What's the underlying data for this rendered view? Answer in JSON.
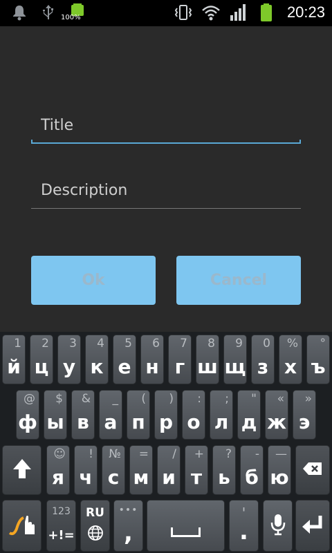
{
  "status_bar": {
    "battery_percent_left": "100%",
    "time": "20:23",
    "icons": [
      "notification-bell-icon",
      "usb-icon",
      "battery-icon",
      "vibrate-icon",
      "wifi-icon",
      "signal-icon",
      "battery-full-icon"
    ]
  },
  "dialog": {
    "title_placeholder": "Title",
    "description_placeholder": "Description",
    "ok_label": "Ok",
    "cancel_label": "Cancel"
  },
  "keyboard": {
    "row1": [
      {
        "main": "й",
        "hint": "1"
      },
      {
        "main": "ц",
        "hint": "2"
      },
      {
        "main": "у",
        "hint": "3"
      },
      {
        "main": "к",
        "hint": "4"
      },
      {
        "main": "е",
        "hint": "5"
      },
      {
        "main": "н",
        "hint": "6"
      },
      {
        "main": "г",
        "hint": "7"
      },
      {
        "main": "ш",
        "hint": "8"
      },
      {
        "main": "щ",
        "hint": "9"
      },
      {
        "main": "з",
        "hint": "0"
      },
      {
        "main": "х",
        "hint": "%"
      },
      {
        "main": "ъ",
        "hint": "°"
      }
    ],
    "row2": [
      {
        "main": "ф",
        "hint": "@"
      },
      {
        "main": "ы",
        "hint": "$"
      },
      {
        "main": "в",
        "hint": "&"
      },
      {
        "main": "а",
        "hint": "_"
      },
      {
        "main": "п",
        "hint": "("
      },
      {
        "main": "р",
        "hint": ")"
      },
      {
        "main": "о",
        "hint": ":"
      },
      {
        "main": "л",
        "hint": ";"
      },
      {
        "main": "д",
        "hint": "\""
      },
      {
        "main": "ж",
        "hint": "«"
      },
      {
        "main": "э",
        "hint": "»"
      }
    ],
    "row3": [
      {
        "main": "я",
        "hint": "☺"
      },
      {
        "main": "ч",
        "hint": "!"
      },
      {
        "main": "с",
        "hint": "№"
      },
      {
        "main": "м",
        "hint": "="
      },
      {
        "main": "и",
        "hint": "/"
      },
      {
        "main": "т",
        "hint": "+"
      },
      {
        "main": "ь",
        "hint": "?"
      },
      {
        "main": "б",
        "hint": "-"
      },
      {
        "main": "ю",
        "hint": "—"
      }
    ],
    "symbols_top": "123",
    "symbols_bottom": "+!=",
    "lang_label": "RU",
    "comma_hint": "•••",
    "comma": ",",
    "period_hint": "'",
    "period": "."
  }
}
